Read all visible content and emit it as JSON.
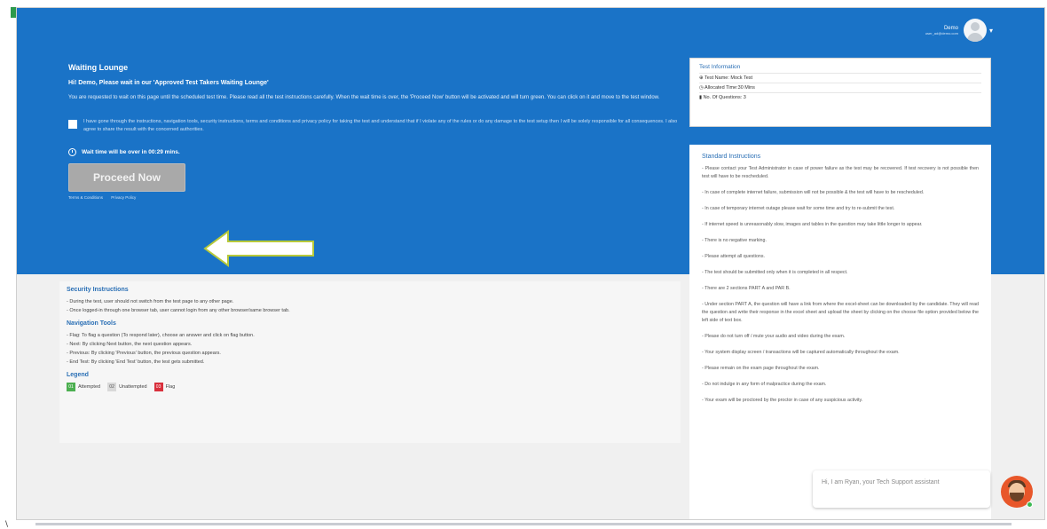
{
  "user": {
    "name": "Demo",
    "email": "user_ad@demo.com"
  },
  "hero": {
    "title": "Waiting Lounge",
    "greeting": "Hi! Demo, Please wait in our 'Approved Test Takers Waiting Lounge'",
    "paragraph": "You are requested to wait on this page until the scheduled test time. Please read all the test instructions carefully. When the wait time is over, the 'Proceed Now' button will be activated and will turn green. You can click on it and move to the test window.",
    "agreement": "I have gone through the instructions, navigation tools, security instructions, terms and conditions and privacy policy for taking the test and understand that if I violate any of the rules or do any damage to the test setup then I will be solely responsible for all consequences. I also agree to share the result with the concerned authorities.",
    "wait_message": "Wait time will be over in 00:29 mins.",
    "proceed_label": "Proceed Now",
    "links": [
      "Terms & Conditions",
      "Privacy Policy"
    ]
  },
  "security": {
    "title": "Security Instructions",
    "items": [
      "- During the test, user should not switch from the test page to any other page.",
      "- Once logged-in through one browser tab, user cannot login from any other browser/same browser tab."
    ]
  },
  "navigation": {
    "title": "Navigation Tools",
    "items": [
      "- Flag: To flag a question (To respond later), choose an answer and click on flag button.",
      "- Next: By clicking Next button, the next question appears.",
      "- Previous: By clicking 'Previous' button, the previous question appears.",
      "- End Test: By clicking 'End Test' button, the test gets submitted."
    ]
  },
  "legend": {
    "title": "Legend",
    "items": [
      {
        "chip": "01",
        "label": "Attempted",
        "color": "#4caf50"
      },
      {
        "chip": "02",
        "label": "Unattempted",
        "color": "#d9d9d9"
      },
      {
        "chip": "03",
        "label": "Flag",
        "color": "#d9303c"
      }
    ]
  },
  "test_info": {
    "title": "Test Information",
    "name": "Test Name: Mock Test",
    "time": "Allocated Time:30 Mins",
    "questions": "No. Of Questions: 3"
  },
  "standard": {
    "title": "Standard Instructions",
    "items": [
      "- Please contact your Test Administrator in case of power failure as the test may be recovered. If test recovery is not possible then test will have to be rescheduled.",
      "- In case of complete internet failure, submission will not be possible & the test will have to be rescheduled.",
      "- In case of temporary internet outage please wait for some time and try to re-submit the test.",
      "- If internet speed is unreasonably slow, images and tables in the question may take little longer to appear.",
      "- There is no negative marking.",
      "- Please attempt all questions.",
      "- The test should be submitted only when it is completed in all respect.",
      "- There are 2 sections PART A and PAR B.",
      "- Under section PART A, the question will have a link from where the excel-sheet can be downloaded by the candidate. They will read the question and write their response in the excel sheet and upload the sheet by clicking on the choose file option provided below the left side of text box.",
      "- Please do not turn off / mute your audio and video during the exam.",
      "- Your system display screen / transactions will be captured automatically throughout the exam.",
      "- Please remain on the exam page throughout the exam.",
      "- Do not indulge in any form of malpractice during the exam.",
      "- Your exam will be proctored by the proctor in case of any suspicious activity."
    ]
  },
  "chat": {
    "message": "Hi, I am Ryan, your Tech Support assistant"
  },
  "colors": {
    "primary_blue": "#1a73c7",
    "button_disabled": "#a9a9a9",
    "arrow_outline": "#b7c93a"
  }
}
